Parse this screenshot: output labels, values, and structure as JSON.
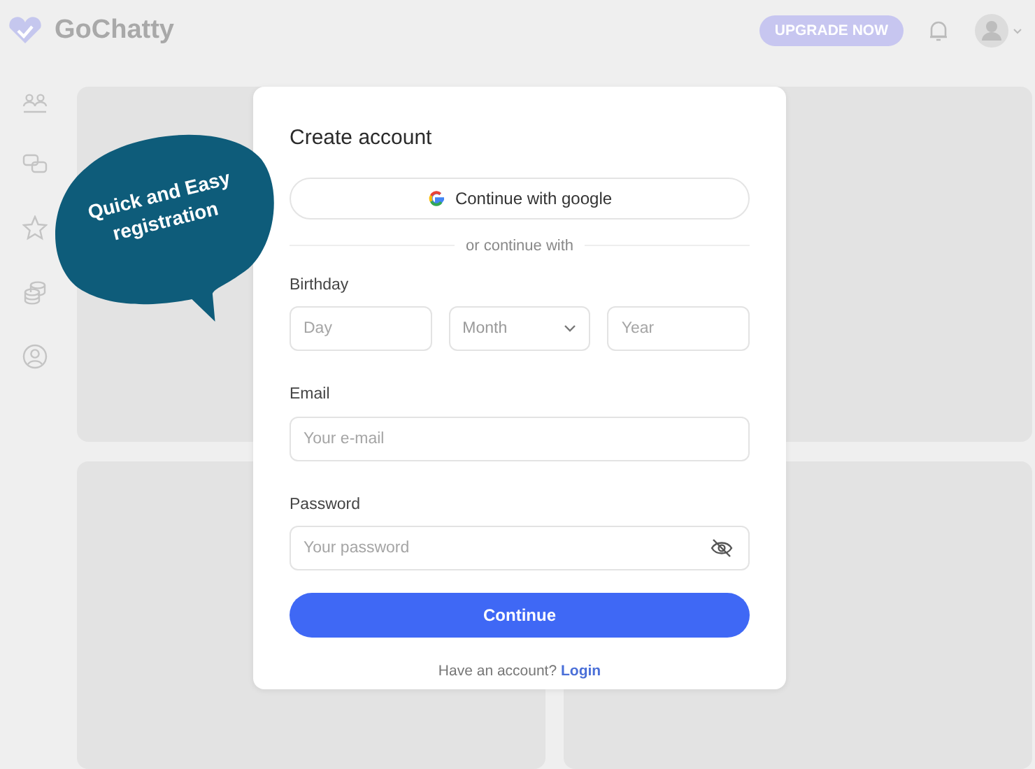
{
  "header": {
    "logo": "GoChatty",
    "upgrade_button": "UPGRADE NOW"
  },
  "callout": {
    "text": "Quick and Easy registration"
  },
  "dialog": {
    "title": "Create account",
    "google_button": "Continue with google",
    "divider": "or continue with",
    "birthday": {
      "label": "Birthday",
      "fields": [
        {
          "kind": "text",
          "placeholder": "Day"
        },
        {
          "kind": "select",
          "placeholder": "Month"
        },
        {
          "kind": "text",
          "placeholder": "Year"
        }
      ]
    },
    "email": {
      "label": "Email",
      "placeholder": "Your e-mail"
    },
    "password": {
      "label": "Password",
      "placeholder": "Your password"
    },
    "continue_button": "Continue",
    "footer": {
      "prompt": "Have an account?",
      "link": "Login"
    }
  }
}
